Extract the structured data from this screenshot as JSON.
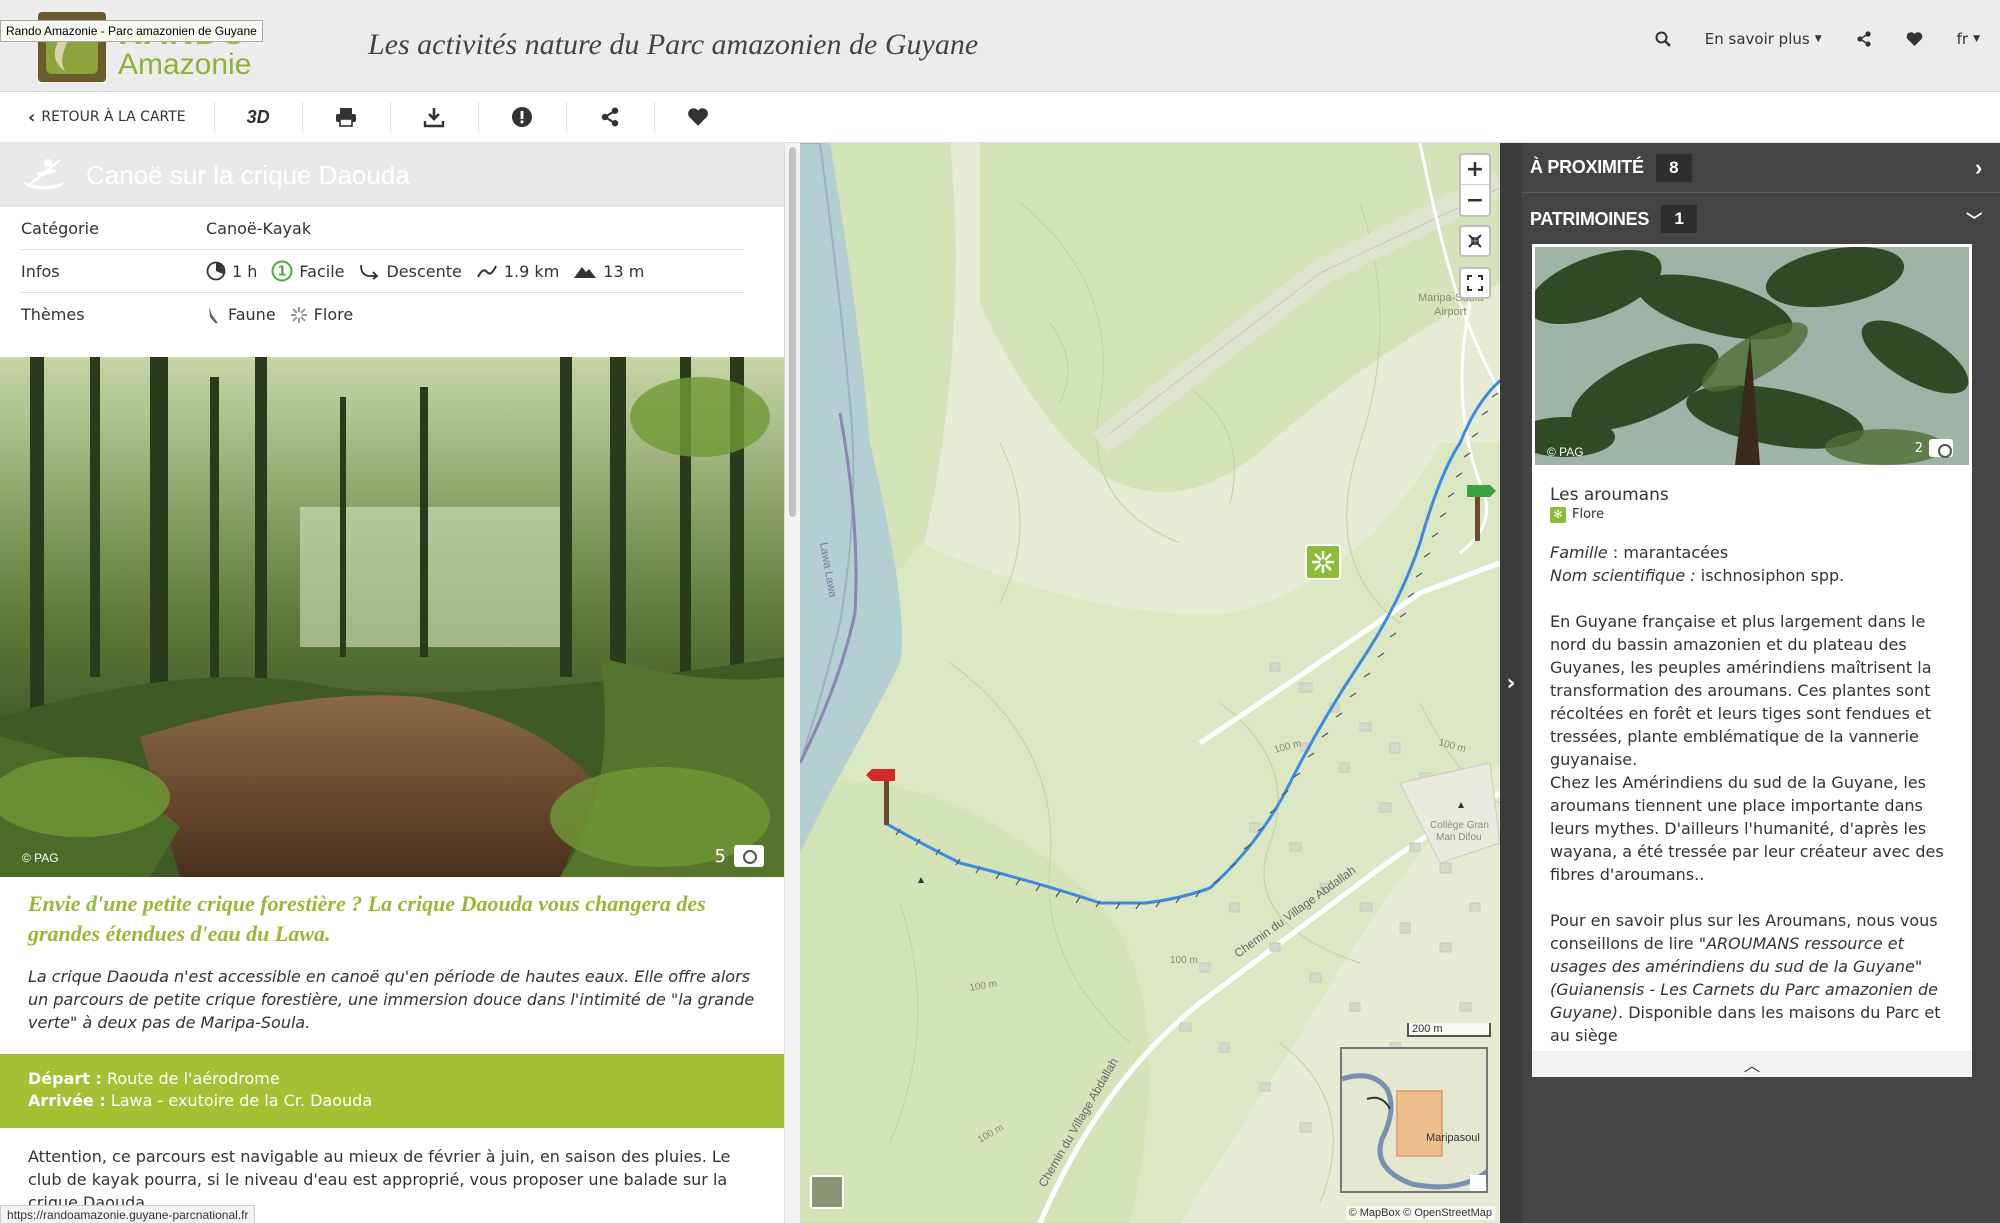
{
  "header": {
    "tooltip": "Rando Amazonie - Parc amazonien de Guyane",
    "logo_top": "RANDO",
    "logo_bottom": "Amazonie",
    "tagline": "Les activités nature du Parc amazonien de Guyane",
    "menu_label": "En savoir plus",
    "lang": "fr"
  },
  "toolbar": {
    "back_label": "Retour à la carte"
  },
  "trek": {
    "title": "Canoë sur la crique Daouda",
    "info_rows": {
      "category_label": "Catégorie",
      "category_value": "Canoë-Kayak",
      "infos_label": "Infos",
      "duration": "1 h",
      "difficulty": "Facile",
      "route": "Descente",
      "length": "1.9 km",
      "elevation": "13 m",
      "themes_label": "Thèmes",
      "theme1": "Faune",
      "theme2": "Flore"
    },
    "photo_credit": "© PAG",
    "photo_count": "5",
    "lead": "Envie d'une petite crique forestière ? La crique Daouda vous changera des grandes étendues d'eau du Lawa.",
    "description": "La crique Daouda n'est accessible en canoë qu'en période de hautes eaux. Elle offre alors un parcours de petite crique forestière, une immersion douce dans l'intimité de \"la grande verte\" à deux pas de Maripa-Soula.",
    "depart_label": "Départ :",
    "depart_value": " Route de l'aérodrome",
    "arrivee_label": "Arrivée :",
    "arrivee_value": " Lawa - exutoire de la Cr. Daouda",
    "warning": "Attention, ce parcours est navigable au mieux de février à juin, en saison des pluies. Le club de kayak pourra, si le niveau d'eau est approprié, vous proposer une balade sur la crique Daouda."
  },
  "status_url": "https://randoamazonie.guyane-parcnational.fr",
  "map": {
    "labels": {
      "airport_1": "Maripa-Soula",
      "airport_2": "Airport",
      "river": "Lawa Lawa",
      "road1": "Chemin du Village Abdallah",
      "road2": "Chemin du Village Abdallah",
      "college_1": "Collège Gran",
      "college_2": "Man Difou",
      "contour_100": "100 m",
      "minimap_label": "Maripasoul"
    },
    "scale": "200 m",
    "attribution": "© MapBox © OpenStreetMap"
  },
  "sidebar": {
    "nearby_label": "À proximité",
    "nearby_count": "8",
    "heritage_label": "Patrimoines",
    "heritage_count": "1",
    "card": {
      "credit": "© PAG",
      "photo_count": "2",
      "title": "Les aroumans",
      "category": "Flore",
      "famille_label": "Famille",
      "famille_value": " : marantacées",
      "nom_label": "Nom scientifique :",
      "nom_value": " ischnosiphon spp.",
      "p1": "En Guyane française et plus largement dans le nord du bassin amazonien et du plateau des Guyanes, les peuples amérindiens maîtrisent la transformation des aroumans. Ces plantes sont récoltées en forêt et leurs tiges sont fendues et tressées, plante emblématique de la vannerie guyanaise.",
      "p2": "Chez les Amérindiens du sud de la Guyane, les aroumans tiennent une place importante dans leurs mythes. D'ailleurs l'humanité, d'après les wayana, a été tressée par leur créateur avec des fibres d'aroumans..",
      "p3_a": "Pour en savoir plus sur les Aroumans, nous vous conseillons de lire ",
      "p3_b": "\"AROUMANS ressource et usages des amérindiens du sud de la Guyane\" (Guianensis - Les Carnets du Parc amazonien de Guyane)",
      "p3_c": ". Disponible dans les maisons du Parc et au siège"
    }
  },
  "colors": {
    "accent_green": "#98b935",
    "route_blue": "#3d8be0",
    "depart_bg": "#a3c132",
    "sidebar_bg": "#444444"
  }
}
